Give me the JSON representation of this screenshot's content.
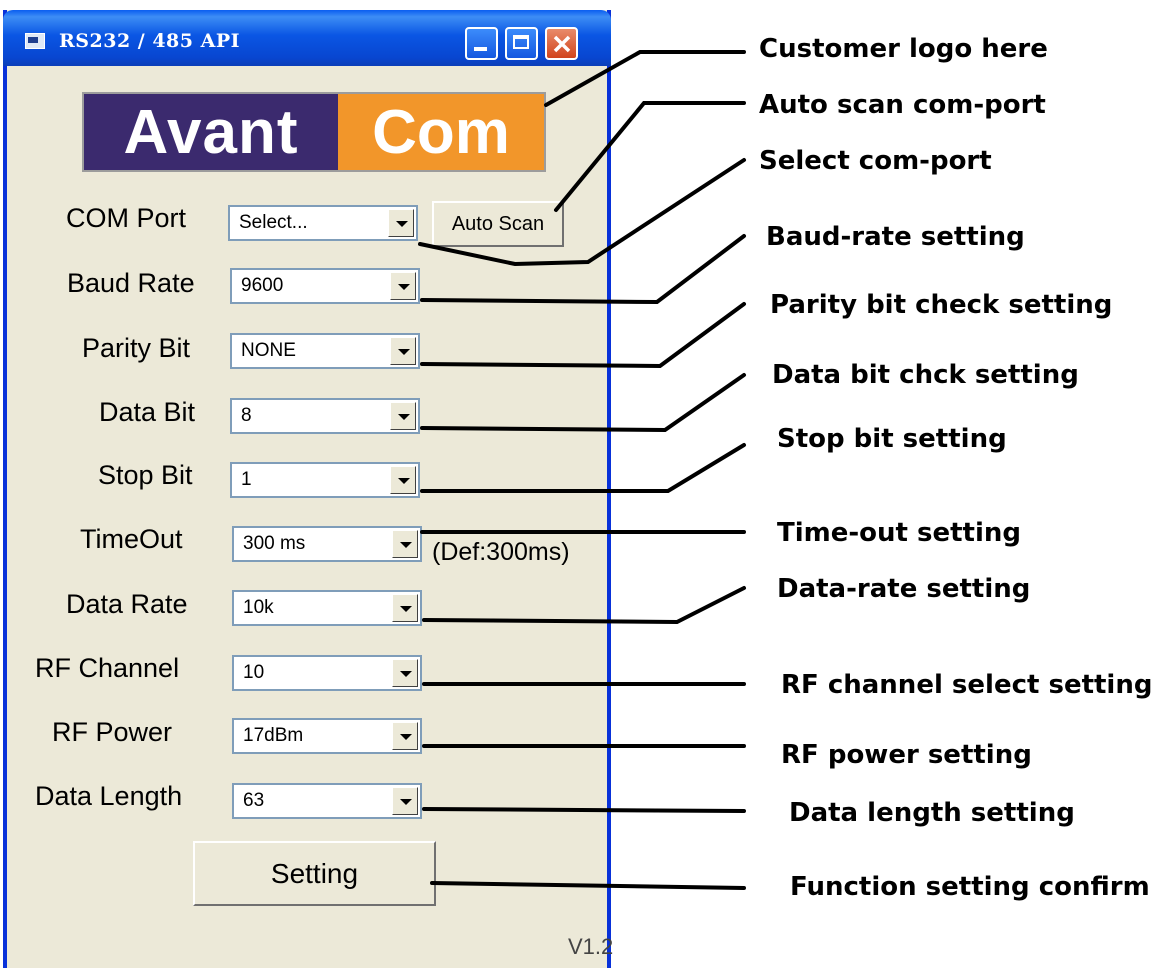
{
  "window": {
    "title": "RS232 / 485 API",
    "icon": "app-window-icon",
    "controls": [
      "minimize-icon",
      "maximize-icon",
      "close-icon"
    ]
  },
  "logo": {
    "left": "Avant",
    "right": "Com",
    "left_color": "#3b2a6e",
    "right_color": "#f2962a"
  },
  "form": {
    "com_port": {
      "label": "COM Port",
      "value": "Select..."
    },
    "auto_scan": "Auto Scan",
    "baud_rate": {
      "label": "Baud Rate",
      "value": "9600"
    },
    "parity_bit": {
      "label": "Parity Bit",
      "value": "NONE"
    },
    "data_bit": {
      "label": "Data Bit",
      "value": "8"
    },
    "stop_bit": {
      "label": "Stop Bit",
      "value": "1"
    },
    "timeout": {
      "label": "TimeOut",
      "value": "300 ms",
      "note": "(Def:300ms)"
    },
    "data_rate": {
      "label": "Data Rate",
      "value": "10k"
    },
    "rf_channel": {
      "label": "RF Channel",
      "value": "10"
    },
    "rf_power": {
      "label": "RF Power",
      "value": "17dBm"
    },
    "data_length": {
      "label": "Data Length",
      "value": "63"
    },
    "setting_button": "Setting",
    "version": "V1.2"
  },
  "annotations": {
    "logo": "Customer logo here",
    "auto_scan": "Auto scan com-port",
    "com_port": "Select com-port",
    "baud_rate": "Baud-rate setting",
    "parity": "Parity bit check setting",
    "data_bit": "Data bit chck setting",
    "stop_bit": "Stop bit setting",
    "timeout": "Time-out setting",
    "data_rate": "Data-rate setting",
    "rf_channel": "RF channel select setting",
    "rf_power": "RF power setting",
    "data_length": "Data length setting",
    "setting": "Function setting confirm"
  }
}
